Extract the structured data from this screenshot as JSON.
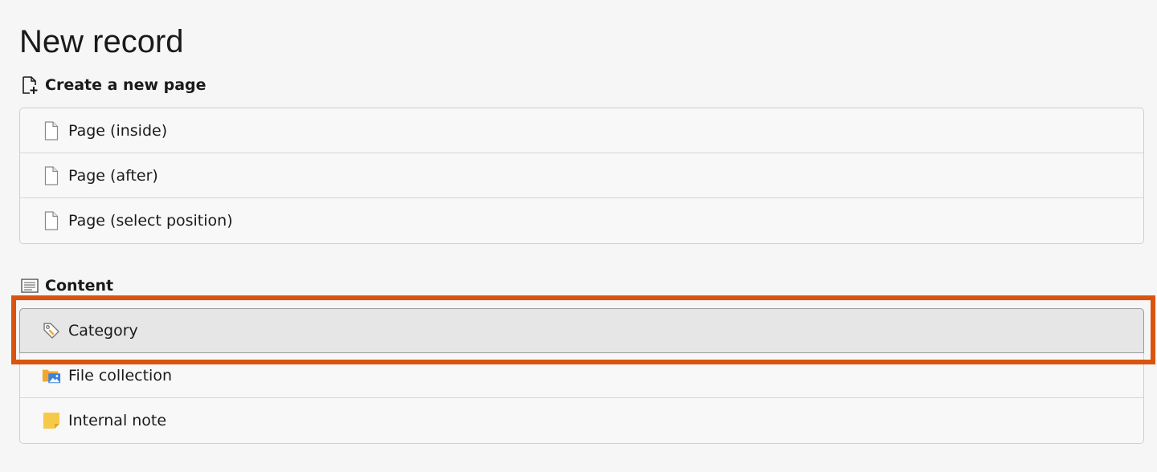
{
  "page": {
    "title": "New record"
  },
  "sections": [
    {
      "heading": "Create a new page",
      "icon": "new-page-icon",
      "items": [
        {
          "label": "Page (inside)",
          "icon": "page-icon"
        },
        {
          "label": "Page (after)",
          "icon": "page-icon"
        },
        {
          "label": "Page (select position)",
          "icon": "page-icon"
        }
      ]
    },
    {
      "heading": "Content",
      "icon": "content-icon",
      "items": [
        {
          "label": "Category",
          "icon": "tag-icon",
          "highlighted": true
        },
        {
          "label": "File collection",
          "icon": "file-collection-icon"
        },
        {
          "label": "Internal note",
          "icon": "note-icon"
        }
      ]
    }
  ],
  "colors": {
    "background": "#f6f6f7",
    "highlight_frame": "#d9540e",
    "highlighted_row": "#e6e6e6",
    "note_yellow": "#f7c948",
    "folder_orange": "#f0a830",
    "image_blue": "#3b82e0"
  }
}
